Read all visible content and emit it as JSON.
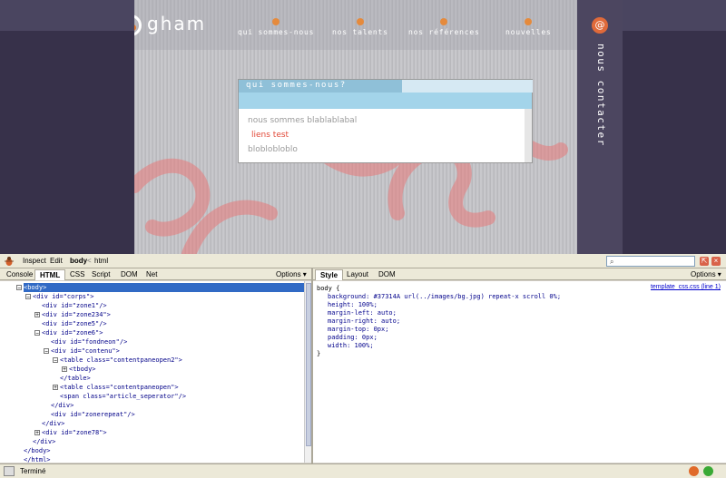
{
  "site": {
    "logo_text": "gham",
    "nav": [
      "qui sommes-nous",
      "nos talents",
      "nos références",
      "nouvelles"
    ],
    "contact_label": "nous contacter",
    "contact_icon": "@",
    "panel": {
      "tab_title": "qui sommes-nous?",
      "line1": "nous sommes blablablabal",
      "link": "liens test",
      "line3": "bloblobloblo"
    },
    "colors": {
      "accent": "#e58a3c",
      "side": "#37314a",
      "panel_tab": "#8fc0d8",
      "link": "#e24b3a"
    }
  },
  "firebug": {
    "toolbar": {
      "inspect": "Inspect",
      "edit": "Edit",
      "crumb_body": "body",
      "crumb_sep": "<",
      "crumb_html": "html"
    },
    "left_tabs": [
      "Console",
      "HTML",
      "CSS",
      "Script",
      "DOM",
      "Net"
    ],
    "left_active": "HTML",
    "right_tabs": [
      "Style",
      "Layout",
      "DOM"
    ],
    "right_active": "Style",
    "options_label": "Options ▾",
    "html_tree": [
      {
        "text": "<body>",
        "indent": 0,
        "exp": "−",
        "selected": true
      },
      {
        "text": "<div id=\"corps\">",
        "indent": 1,
        "exp": "−"
      },
      {
        "text": "<div id=\"zone1\"/>",
        "indent": 2,
        "exp": ""
      },
      {
        "text": "<div id=\"zone234\">",
        "indent": 2,
        "exp": "+"
      },
      {
        "text": "<div id=\"zone5\"/>",
        "indent": 2,
        "exp": ""
      },
      {
        "text": "<div id=\"zone6\">",
        "indent": 2,
        "exp": "−"
      },
      {
        "text": "<div id=\"fondneon\"/>",
        "indent": 3,
        "exp": ""
      },
      {
        "text": "<div id=\"contenu\">",
        "indent": 3,
        "exp": "−"
      },
      {
        "text": "<table class=\"contentpaneopen2\">",
        "indent": 4,
        "exp": "−"
      },
      {
        "text": "<tbody>",
        "indent": 5,
        "exp": "+"
      },
      {
        "text": "</table>",
        "indent": 4,
        "exp": ""
      },
      {
        "text": "<table class=\"contentpaneopen\">",
        "indent": 4,
        "exp": "+"
      },
      {
        "text": "<span class=\"article_seperator\"/>",
        "indent": 4,
        "exp": ""
      },
      {
        "text": "</div>",
        "indent": 3,
        "exp": ""
      },
      {
        "text": "<div id=\"zonerepeat\"/>",
        "indent": 3,
        "exp": ""
      },
      {
        "text": "</div>",
        "indent": 2,
        "exp": ""
      },
      {
        "text": "<div id=\"zone78\">",
        "indent": 2,
        "exp": "+"
      },
      {
        "text": "</div>",
        "indent": 1,
        "exp": ""
      },
      {
        "text": "</body>",
        "indent": 0,
        "exp": ""
      },
      {
        "text": "</html>",
        "indent": 0,
        "exp": ""
      }
    ],
    "css": {
      "source": "template_css.css (line 1)",
      "selector": "body {",
      "rules": [
        "background: #37314A url(../images/bg.jpg) repeat-x scroll 0%;",
        "height: 100%;",
        "margin-left: auto;",
        "margin-right: auto;",
        "margin-top: 0px;",
        "padding: 0px;",
        "width: 100%;"
      ],
      "close": "}"
    },
    "status": "Terminé"
  }
}
